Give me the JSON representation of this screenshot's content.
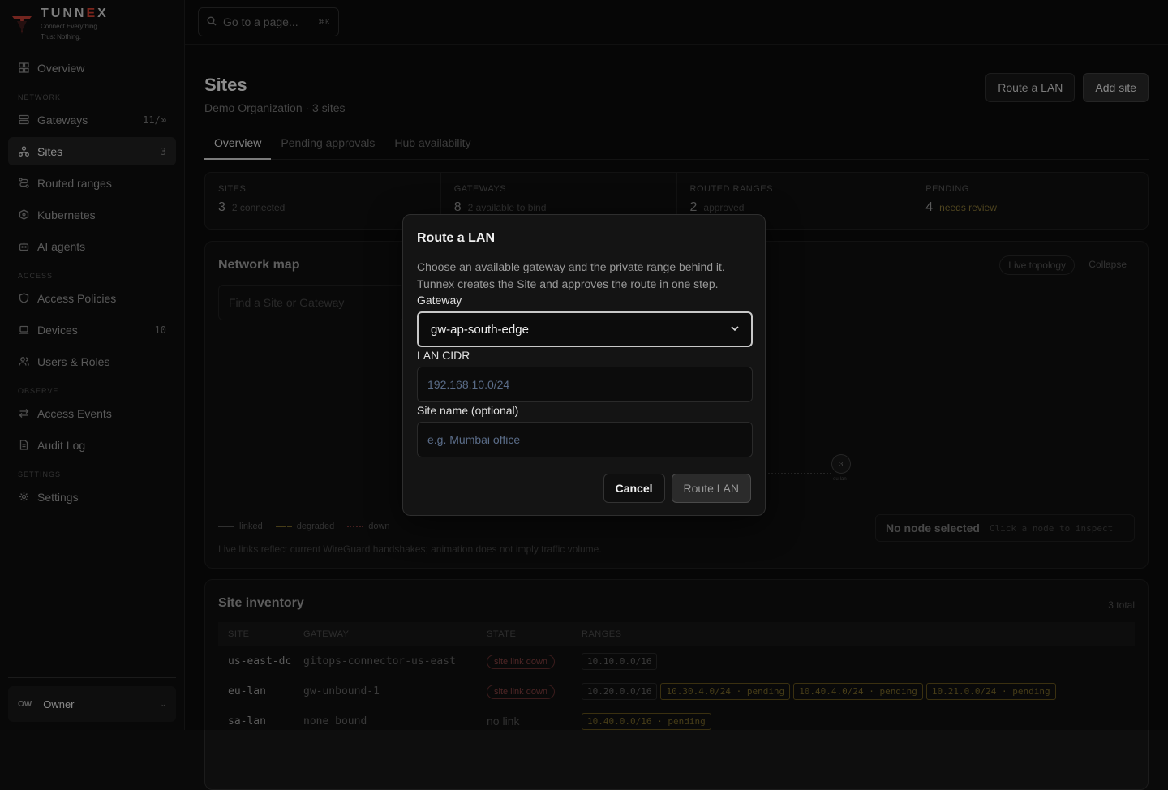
{
  "brand": {
    "name_part1": "TUNN",
    "name_x": "E",
    "name_part2": "X",
    "tagline1": "Connect Everything.",
    "tagline2": "Trust Nothing."
  },
  "sidebar": {
    "overview": {
      "label": "Overview",
      "icon": "grid-icon"
    },
    "sections": {
      "network": "NETWORK",
      "access": "ACCESS",
      "observe": "OBSERVE",
      "settings": "SETTINGS"
    },
    "items": {
      "gateways": {
        "label": "Gateways",
        "count": "11/∞"
      },
      "sites": {
        "label": "Sites",
        "count": "3"
      },
      "routed_ranges": {
        "label": "Routed ranges"
      },
      "kubernetes": {
        "label": "Kubernetes"
      },
      "ai_agents": {
        "label": "AI agents"
      },
      "access_policies": {
        "label": "Access Policies"
      },
      "devices": {
        "label": "Devices",
        "count": "10"
      },
      "users_roles": {
        "label": "Users & Roles"
      },
      "access_events": {
        "label": "Access Events"
      },
      "audit_log": {
        "label": "Audit Log"
      },
      "settings": {
        "label": "Settings"
      }
    },
    "user": {
      "initials": "OW",
      "name": "Owner"
    }
  },
  "topbar": {
    "search_placeholder": "Go to a page...",
    "shortcut": "⌘K"
  },
  "page": {
    "title": "Sites",
    "subtitle": "Demo Organization · 3 sites",
    "btn_route": "Route a LAN",
    "btn_add": "Add site",
    "tabs": [
      "Overview",
      "Pending approvals",
      "Hub availability"
    ]
  },
  "stats": [
    {
      "label": "SITES",
      "value": "3",
      "note": "2 connected"
    },
    {
      "label": "GATEWAYS",
      "value": "8",
      "note": "2 available to bind"
    },
    {
      "label": "ROUTED RANGES",
      "value": "2",
      "note": "approved"
    },
    {
      "label": "PENDING",
      "value": "4",
      "note": "needs review"
    }
  ],
  "map": {
    "title": "Network map",
    "find_placeholder": "Find a Site or Gateway",
    "chip_live": "Live topology",
    "chip_collapse": "Collapse",
    "legend_linked": "linked",
    "legend_degraded": "degraded",
    "legend_down": "down",
    "note": "Live links reflect current WireGuard handshakes; animation does not imply traffic volume.",
    "node_none": "No node selected",
    "node_hint": "Click a node to inspect",
    "node_count": "3",
    "node_label": "eu-lan"
  },
  "inventory": {
    "title": "Site inventory",
    "total": "3 total",
    "headers": [
      "SITE",
      "GATEWAY",
      "STATE",
      "RANGES"
    ],
    "rows": [
      {
        "site": "us-east-dc",
        "gateway": "gitops-connector-us-east",
        "state": "site link down",
        "ranges": [
          "10.10.0.0/16"
        ],
        "pending": []
      },
      {
        "site": "eu-lan",
        "gateway": "gw-unbound-1",
        "state": "site link down",
        "ranges": [
          "10.20.0.0/16"
        ],
        "pending": [
          "10.30.4.0/24 · pending",
          "10.40.4.0/24 · pending",
          "10.21.0.0/24 · pending"
        ]
      },
      {
        "site": "sa-lan",
        "gateway": "none bound",
        "state": "no link",
        "ranges": [],
        "pending": [
          "10.40.0.0/16 · pending"
        ]
      }
    ]
  },
  "modal": {
    "title": "Route a LAN",
    "description": "Choose an available gateway and the private range behind it. Tunnex creates the Site and approves the route in one step.",
    "gateway_label": "Gateway",
    "gateway_value": "gw-ap-south-edge",
    "cidr_label": "LAN CIDR",
    "cidr_placeholder": "192.168.10.0/24",
    "name_label": "Site name (optional)",
    "name_placeholder": "e.g. Mumbai office",
    "cancel": "Cancel",
    "submit": "Route LAN"
  }
}
